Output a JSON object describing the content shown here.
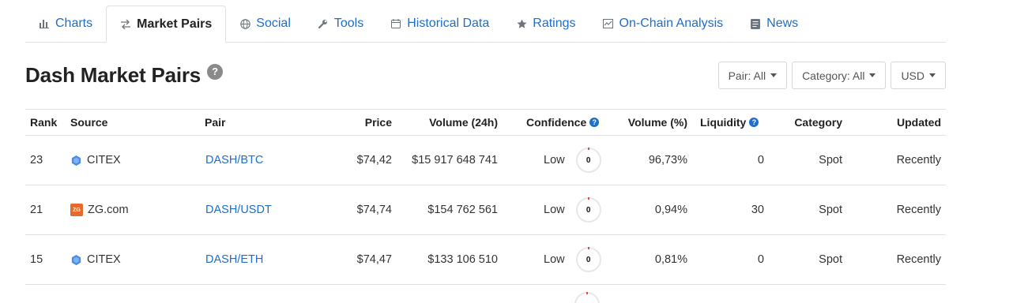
{
  "tabs": [
    {
      "label": "Charts",
      "icon": "bar-chart-icon",
      "active": false
    },
    {
      "label": "Market Pairs",
      "icon": "exchange-arrows-icon",
      "active": true
    },
    {
      "label": "Social",
      "icon": "globe-icon",
      "active": false
    },
    {
      "label": "Tools",
      "icon": "wrench-icon",
      "active": false
    },
    {
      "label": "Historical Data",
      "icon": "calendar-icon",
      "active": false
    },
    {
      "label": "Ratings",
      "icon": "star-icon",
      "active": false
    },
    {
      "label": "On-Chain Analysis",
      "icon": "line-chart-icon",
      "active": false
    },
    {
      "label": "News",
      "icon": "newspaper-icon",
      "active": false
    }
  ],
  "page": {
    "title": "Dash Market Pairs",
    "help": "?"
  },
  "filters": {
    "pair": "Pair: All",
    "category": "Category: All",
    "currency": "USD"
  },
  "table": {
    "headers": {
      "rank": "Rank",
      "source": "Source",
      "pair": "Pair",
      "price": "Price",
      "volume": "Volume (24h)",
      "confidence": "Confidence",
      "volume_pct": "Volume (%)",
      "liquidity": "Liquidity",
      "category": "Category",
      "updated": "Updated"
    },
    "rows": [
      {
        "rank": "23",
        "source": "CITEX",
        "logo": "citex",
        "pair": "DASH/BTC",
        "price": "$74,42",
        "volume": "$15 917 648 741",
        "confidence": "Low",
        "score": "0",
        "volume_pct": "96,73%",
        "liquidity": "0",
        "category": "Spot",
        "updated": "Recently"
      },
      {
        "rank": "21",
        "source": "ZG.com",
        "logo": "zg",
        "pair": "DASH/USDT",
        "price": "$74,74",
        "volume": "$154 762 561",
        "confidence": "Low",
        "score": "0",
        "volume_pct": "0,94%",
        "liquidity": "30",
        "category": "Spot",
        "updated": "Recently"
      },
      {
        "rank": "15",
        "source": "CITEX",
        "logo": "citex",
        "pair": "DASH/ETH",
        "price": "$74,47",
        "volume": "$133 106 510",
        "confidence": "Low",
        "score": "0",
        "volume_pct": "0,81%",
        "liquidity": "0",
        "category": "Spot",
        "updated": "Recently"
      }
    ]
  },
  "zg_logo_text": "ZG",
  "colors": {
    "link": "#1f6ecb",
    "score_arc": "#e34a4a",
    "zg_logo": "#e86a2b",
    "citex_logo": "#4a8fe7"
  }
}
